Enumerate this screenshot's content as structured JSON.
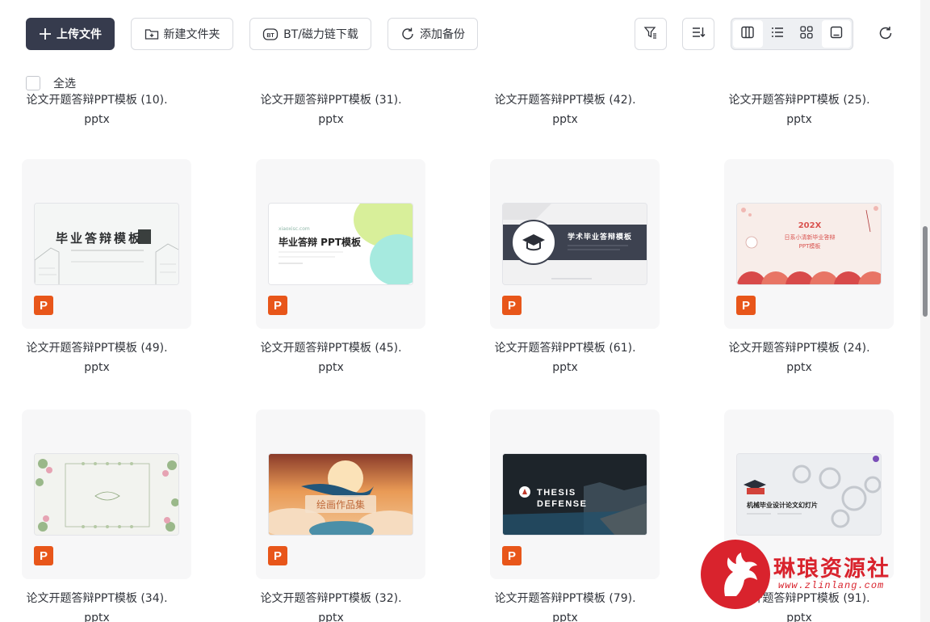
{
  "toolbar": {
    "upload_label": "上传文件",
    "new_folder_label": "新建文件夹",
    "bt_label": "BT/磁力链下载",
    "backup_label": "添加备份"
  },
  "select_all_label": "全选",
  "files": [
    {
      "name_line1": "论文开题答辩PPT模板 (10).",
      "name_line2": "pptx"
    },
    {
      "name_line1": "论文开题答辩PPT模板 (31).",
      "name_line2": "pptx"
    },
    {
      "name_line1": "论文开题答辩PPT模板 (42).",
      "name_line2": "pptx"
    },
    {
      "name_line1": "论文开题答辩PPT模板 (25).",
      "name_line2": "pptx"
    },
    {
      "name_line1": "论文开题答辩PPT模板 (49).",
      "name_line2": "pptx",
      "thumb_title": "毕业答辩模板"
    },
    {
      "name_line1": "论文开题答辩PPT模板 (45).",
      "name_line2": "pptx",
      "thumb_title": "毕业答辩 PPT模板",
      "thumb_sub": "xiaoxisc.com"
    },
    {
      "name_line1": "论文开题答辩PPT模板 (61).",
      "name_line2": "pptx",
      "thumb_title": "学术毕业答辩模板"
    },
    {
      "name_line1": "论文开题答辩PPT模板 (24).",
      "name_line2": "pptx",
      "thumb_title": "202X",
      "thumb_sub": "日系小清新毕业答辩",
      "thumb_sub2": "PPT模板"
    },
    {
      "name_line1": "论文开题答辩PPT模板 (34).",
      "name_line2": "pptx"
    },
    {
      "name_line1": "论文开题答辩PPT模板 (32).",
      "name_line2": "pptx",
      "thumb_title": "绘画作品集"
    },
    {
      "name_line1": "论文开题答辩PPT模板 (79).",
      "name_line2": "pptx",
      "thumb_title": "THESIS",
      "thumb_sub": "DEFENSE"
    },
    {
      "name_line1": "论文开题答辩PPT模板 (91).",
      "name_line2": "pptx",
      "thumb_title": "机械毕业设计论文幻灯片"
    }
  ],
  "badge_letter": "P",
  "watermark": {
    "title": "琳琅资源社",
    "url": "www.zlinlang.com"
  },
  "colors": {
    "primary_button": "#363b4d",
    "ppt_badge": "#e8561a",
    "watermark": "#d9232d"
  }
}
